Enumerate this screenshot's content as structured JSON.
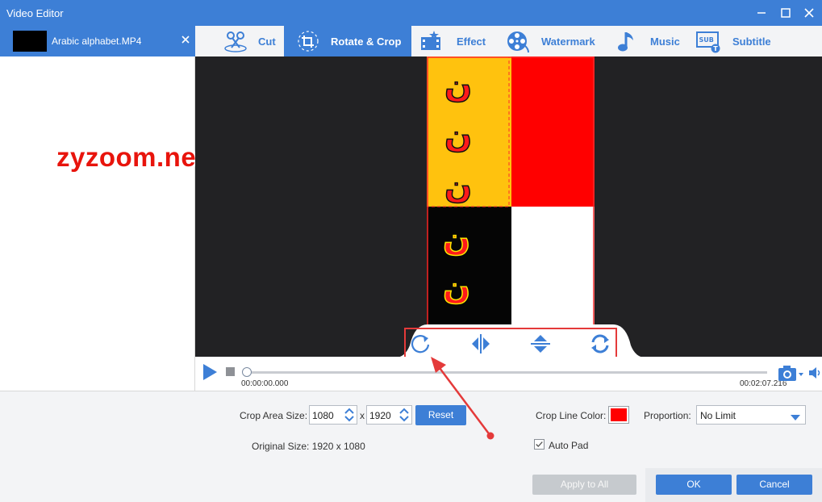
{
  "window": {
    "title": "Video Editor"
  },
  "file": {
    "name": "Arabic alphabet.MP4"
  },
  "overlay_watermark": "zyzoom.net",
  "tabs": [
    {
      "label": "Cut",
      "icon": "scissors-icon",
      "active": false
    },
    {
      "label": "Rotate & Crop",
      "icon": "crop-icon",
      "active": true
    },
    {
      "label": "Effect",
      "icon": "effect-icon",
      "active": false
    },
    {
      "label": "Watermark",
      "icon": "film-reel-icon",
      "active": false
    },
    {
      "label": "Music",
      "icon": "music-note-icon",
      "active": false
    },
    {
      "label": "Subtitle",
      "icon": "subtitle-icon",
      "active": false
    }
  ],
  "video_text": "ن",
  "timeline": {
    "current_time": "00:00:00.000",
    "total_time": "00:02:07.216",
    "progress": 0
  },
  "crop": {
    "area_label": "Crop Area Size:",
    "width": "1080",
    "separator": "x",
    "height": "1920",
    "reset_label": "Reset",
    "original_label": "Original Size: 1920 x 1080",
    "line_color_label": "Crop Line Color:",
    "line_color": "#ff0000",
    "proportion_label": "Proportion:",
    "proportion_value": "No Limit",
    "auto_pad_label": "Auto Pad",
    "auto_pad_checked": true
  },
  "actions": {
    "apply_all": "Apply to All",
    "ok": "OK",
    "cancel": "Cancel"
  },
  "colors": {
    "accent": "#3d7fd6",
    "annotation": "#e43a3a",
    "preview_bg": "#222224"
  }
}
